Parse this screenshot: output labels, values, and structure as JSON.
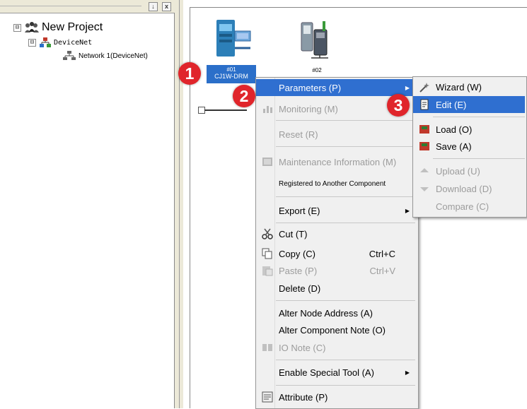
{
  "tree": {
    "root_label": "New Project",
    "devicenet_label": "DeviceNet",
    "network_label": "Network 1(DeviceNet)",
    "expand_root": "⊟",
    "expand_devicenet": "⊟",
    "close_glyph": "x",
    "pin_glyph": "↓"
  },
  "canvas": {
    "node1": {
      "number": "#01",
      "model": "CJ1W-DRM"
    },
    "node2": {
      "number": "#02"
    }
  },
  "context_menu": {
    "items": [
      {
        "label": "Parameters (P)",
        "submenu": true,
        "highlighted": true
      },
      {
        "label": "Monitoring (M)",
        "disabled": true
      },
      {
        "label": "Reset (R)",
        "disabled": true
      },
      {
        "label": "Maintenance Information (M)",
        "disabled": true
      },
      {
        "label": "Registered to Another Component"
      },
      {
        "label": "Export (E)",
        "submenu": true
      },
      {
        "label": "Cut (T)"
      },
      {
        "label": "Copy (C)",
        "shortcut": "Ctrl+C"
      },
      {
        "label": "Paste (P)",
        "shortcut": "Ctrl+V",
        "disabled": true
      },
      {
        "label": "Delete (D)"
      },
      {
        "label": "Alter Node Address (A)"
      },
      {
        "label": "Alter Component Note (O)"
      },
      {
        "label": "IO Note (C)",
        "disabled": true
      },
      {
        "label": "Enable Special Tool (A)",
        "submenu": true
      },
      {
        "label": "Attribute (P)"
      }
    ]
  },
  "submenu": {
    "items": [
      {
        "label": "Wizard (W)"
      },
      {
        "label": "Edit (E)",
        "highlighted": true
      },
      {
        "label": "Load (O)"
      },
      {
        "label": "Save (A)"
      },
      {
        "label": "Upload (U)",
        "disabled": true
      },
      {
        "label": "Download (D)",
        "disabled": true
      },
      {
        "label": "Compare (C)",
        "disabled": true
      }
    ]
  },
  "step_badges": [
    "1",
    "2",
    "3"
  ],
  "colors": {
    "highlight": "#2f6fd0",
    "badge": "#e0252b",
    "node_selection": "#2b6fc9"
  },
  "icons": [
    "project-icon",
    "devicenet-icon",
    "network-icon",
    "node1-device-icon",
    "node2-device-icon",
    "monitoring-icon",
    "maintenance-icon",
    "cut-icon",
    "copy-icon",
    "paste-icon",
    "io-note-icon",
    "attribute-icon",
    "wizard-icon",
    "edit-icon",
    "load-icon",
    "save-icon",
    "upload-icon",
    "download-icon"
  ]
}
